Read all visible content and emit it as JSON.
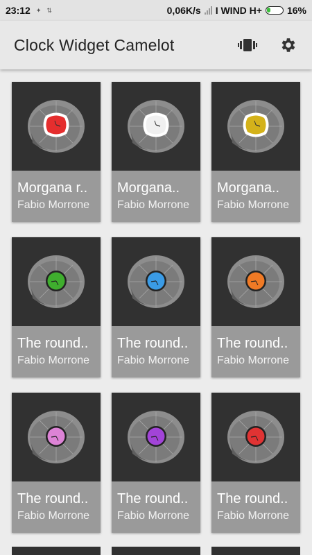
{
  "status": {
    "time": "23:12",
    "speed": "0,06K/s",
    "carrier": "I WIND H+",
    "battery": "16%"
  },
  "app_bar": {
    "title": "Clock Widget Camelot",
    "icons": [
      "vibrate-icon",
      "gear-icon"
    ]
  },
  "cards": [
    {
      "title": "Morgana r..",
      "author": "Fabio Morrone",
      "style": "flower",
      "color": "#e52e2e"
    },
    {
      "title": "Morgana..",
      "author": "Fabio Morrone",
      "style": "flower",
      "color": "#f0f0f0"
    },
    {
      "title": "Morgana..",
      "author": "Fabio Morrone",
      "style": "flower",
      "color": "#d4b21a"
    },
    {
      "title": "The round..",
      "author": "Fabio Morrone",
      "style": "round",
      "color": "#3fae2e"
    },
    {
      "title": "The round..",
      "author": "Fabio Morrone",
      "style": "round",
      "color": "#3a9be6"
    },
    {
      "title": "The round..",
      "author": "Fabio Morrone",
      "style": "round",
      "color": "#f07a25"
    },
    {
      "title": "The round..",
      "author": "Fabio Morrone",
      "style": "round",
      "color": "#dd83d6"
    },
    {
      "title": "The round..",
      "author": "Fabio Morrone",
      "style": "round",
      "color": "#a244d8"
    },
    {
      "title": "The round..",
      "author": "Fabio Morrone",
      "style": "round",
      "color": "#e03333"
    }
  ]
}
